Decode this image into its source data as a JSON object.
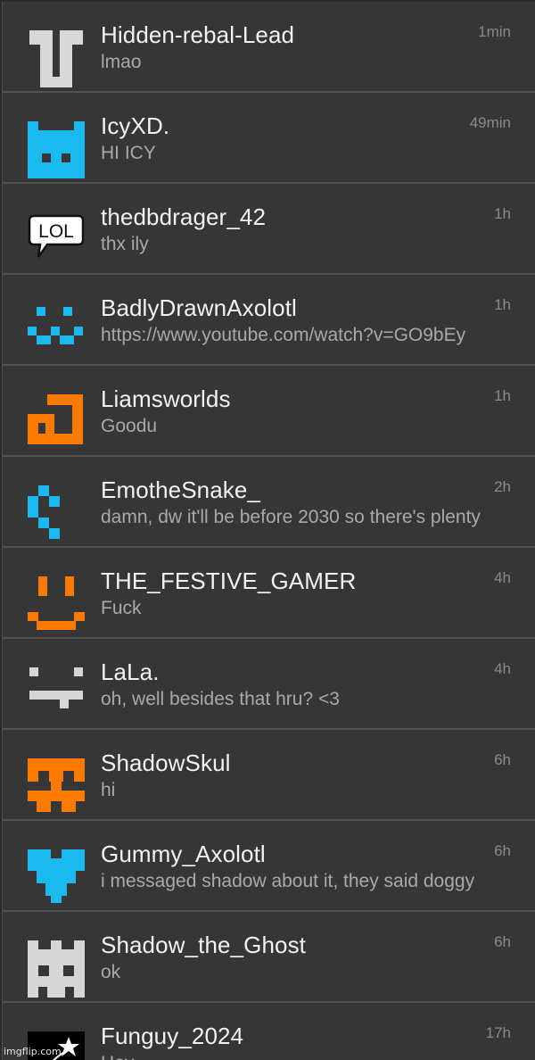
{
  "conversations": [
    {
      "name": "Hidden-rebal-Lead",
      "preview": "lmao",
      "time": "1min",
      "avatar_icon": "light-gray-totem-avatar-icon"
    },
    {
      "name": "IcyXD.",
      "preview": "HI ICY",
      "time": "49min",
      "avatar_icon": "blue-cat-avatar-icon"
    },
    {
      "name": "thedbdrager_42",
      "preview": "thx ily",
      "time": "1h",
      "avatar_icon": "lol-speech-bubble-avatar-icon",
      "avatar_text": "LOL"
    },
    {
      "name": "BadlyDrawnAxolotl",
      "preview": "https://www.youtube.com/watch?v=GO9bEy",
      "time": "1h",
      "avatar_icon": "blue-smiley-avatar-icon"
    },
    {
      "name": "Liamsworlds",
      "preview": "Goodu",
      "time": "1h",
      "avatar_icon": "orange-spiral-avatar-icon"
    },
    {
      "name": "EmotheSnake_",
      "preview": "damn, dw it'll be before 2030 so there's plenty",
      "time": "2h",
      "avatar_icon": "blue-snake-avatar-icon"
    },
    {
      "name": "THE_FESTIVE_GAMER",
      "preview": "Fuck",
      "time": "4h",
      "avatar_icon": "orange-smiley-avatar-icon"
    },
    {
      "name": "LaLa.",
      "preview": "oh, well besides that hru? <3",
      "time": "4h",
      "avatar_icon": "gray-face-avatar-icon"
    },
    {
      "name": "ShadowSkul",
      "preview": "hi",
      "time": "6h",
      "avatar_icon": "orange-skull-avatar-icon"
    },
    {
      "name": "Gummy_Axolotl",
      "preview": "i messaged shadow about it, they said doggy",
      "time": "6h",
      "avatar_icon": "blue-heart-avatar-icon"
    },
    {
      "name": "Shadow_the_Ghost",
      "preview": "ok",
      "time": "6h",
      "avatar_icon": "gray-ghost-avatar-icon"
    },
    {
      "name": "Funguy_2024",
      "preview": "Hey",
      "time": "17h",
      "avatar_icon": "shooting-star-avatar-icon"
    }
  ],
  "watermark": "imgflip.com",
  "colors": {
    "row_bg": "#363636",
    "divider": "#525252",
    "name_text": "#f2f2f2",
    "preview_text": "#a9a9a9",
    "time_text": "#8a8a8a",
    "avatar_blue": "#1cb8f0",
    "avatar_orange": "#ff7a00",
    "avatar_gray": "#d6d6d6"
  }
}
